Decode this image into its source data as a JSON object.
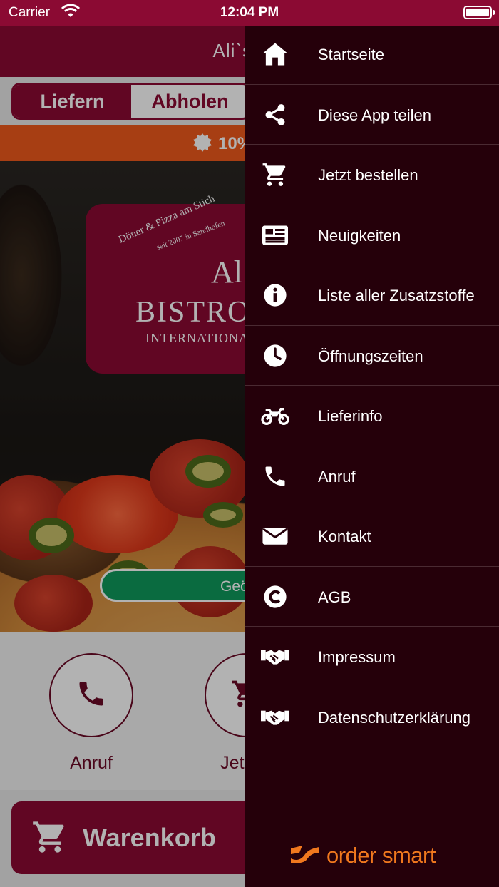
{
  "status_bar": {
    "carrier": "Carrier",
    "time": "12:04 PM"
  },
  "header": {
    "title": "Ali`s Bis"
  },
  "order_mode": {
    "options": [
      "Liefern",
      "Abholen"
    ],
    "selected": "Liefern"
  },
  "promo": {
    "text": "10%"
  },
  "logo": {
    "arc_small": "seit 2007 in Sandhofen",
    "arc_line": "Döner & Pizza am Stich",
    "name_top": "Al",
    "name_main": "BISTRO",
    "subtitle": "INTERNATIONA"
  },
  "open_status": {
    "text": "Geö"
  },
  "quick_actions": [
    {
      "label": "Anruf",
      "icon": "phone-icon"
    },
    {
      "label": "Jetzt b",
      "icon": "cart-icon"
    }
  ],
  "cart": {
    "label": "Warenkorb",
    "icon": "cart-icon"
  },
  "drawer": {
    "items": [
      {
        "label": "Startseite",
        "icon": "home-icon"
      },
      {
        "label": "Diese App teilen",
        "icon": "share-icon"
      },
      {
        "label": "Jetzt bestellen",
        "icon": "cart-icon"
      },
      {
        "label": "Neuigkeiten",
        "icon": "newspaper-icon"
      },
      {
        "label": "Liste aller Zusatzstoffe",
        "icon": "info-icon"
      },
      {
        "label": "Öffnungszeiten",
        "icon": "clock-icon"
      },
      {
        "label": "Lieferinfo",
        "icon": "motorcycle-icon"
      },
      {
        "label": "Anruf",
        "icon": "phone-icon"
      },
      {
        "label": "Kontakt",
        "icon": "envelope-icon"
      },
      {
        "label": "AGB",
        "icon": "copyright-icon"
      },
      {
        "label": "Impressum",
        "icon": "handshake-icon"
      },
      {
        "label": "Datenschutzerklärung",
        "icon": "handshake-icon"
      }
    ],
    "brand": "order smart"
  },
  "colors": {
    "primary": "#8b0a33",
    "drawer_bg": "#25000a",
    "promo": "#f05a1c",
    "open_green": "#0f9a5c",
    "brand_orange": "#f0781e"
  }
}
